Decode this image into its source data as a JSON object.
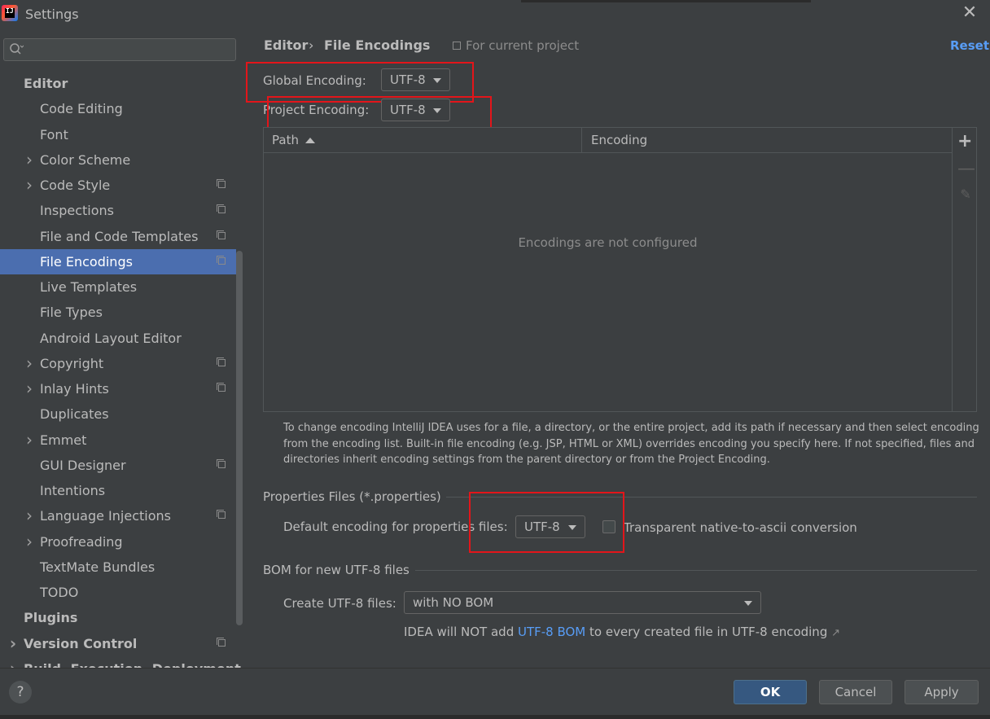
{
  "window": {
    "title": "Settings",
    "close_icon": "close-icon"
  },
  "search": {
    "placeholder": ""
  },
  "sidebar": {
    "items": [
      {
        "label": "Editor",
        "level": 0,
        "expandable": false,
        "project_scope": false,
        "selected": false
      },
      {
        "label": "Code Editing",
        "level": 1,
        "expandable": false,
        "project_scope": false,
        "selected": false
      },
      {
        "label": "Font",
        "level": 1,
        "expandable": false,
        "project_scope": false,
        "selected": false
      },
      {
        "label": "Color Scheme",
        "level": 1,
        "expandable": true,
        "project_scope": false,
        "selected": false
      },
      {
        "label": "Code Style",
        "level": 1,
        "expandable": true,
        "project_scope": true,
        "selected": false
      },
      {
        "label": "Inspections",
        "level": 1,
        "expandable": false,
        "project_scope": true,
        "selected": false
      },
      {
        "label": "File and Code Templates",
        "level": 1,
        "expandable": false,
        "project_scope": true,
        "selected": false
      },
      {
        "label": "File Encodings",
        "level": 1,
        "expandable": false,
        "project_scope": true,
        "selected": true
      },
      {
        "label": "Live Templates",
        "level": 1,
        "expandable": false,
        "project_scope": false,
        "selected": false
      },
      {
        "label": "File Types",
        "level": 1,
        "expandable": false,
        "project_scope": false,
        "selected": false
      },
      {
        "label": "Android Layout Editor",
        "level": 1,
        "expandable": false,
        "project_scope": false,
        "selected": false
      },
      {
        "label": "Copyright",
        "level": 1,
        "expandable": true,
        "project_scope": true,
        "selected": false
      },
      {
        "label": "Inlay Hints",
        "level": 1,
        "expandable": true,
        "project_scope": true,
        "selected": false
      },
      {
        "label": "Duplicates",
        "level": 1,
        "expandable": false,
        "project_scope": false,
        "selected": false
      },
      {
        "label": "Emmet",
        "level": 1,
        "expandable": true,
        "project_scope": false,
        "selected": false
      },
      {
        "label": "GUI Designer",
        "level": 1,
        "expandable": false,
        "project_scope": true,
        "selected": false
      },
      {
        "label": "Intentions",
        "level": 1,
        "expandable": false,
        "project_scope": false,
        "selected": false
      },
      {
        "label": "Language Injections",
        "level": 1,
        "expandable": true,
        "project_scope": true,
        "selected": false
      },
      {
        "label": "Proofreading",
        "level": 1,
        "expandable": true,
        "project_scope": false,
        "selected": false
      },
      {
        "label": "TextMate Bundles",
        "level": 1,
        "expandable": false,
        "project_scope": false,
        "selected": false
      },
      {
        "label": "TODO",
        "level": 1,
        "expandable": false,
        "project_scope": false,
        "selected": false
      },
      {
        "label": "Plugins",
        "level": 0,
        "expandable": false,
        "project_scope": false,
        "selected": false
      },
      {
        "label": "Version Control",
        "level": 0,
        "expandable": true,
        "project_scope": true,
        "selected": false
      },
      {
        "label": "Build, Execution, Deployment",
        "level": 0,
        "expandable": true,
        "project_scope": false,
        "selected": false
      }
    ]
  },
  "breadcrumb": {
    "parent": "Editor",
    "separator": "›",
    "current": "File Encodings",
    "scope": "For current project"
  },
  "reset_label": "Reset",
  "global_encoding": {
    "label": "Global Encoding:",
    "value": "UTF-8"
  },
  "project_encoding": {
    "label": "Project Encoding:",
    "value": "UTF-8"
  },
  "table": {
    "columns": [
      "Path",
      "Encoding"
    ],
    "empty_text": "Encodings are not configured",
    "toolbar": {
      "add": "+",
      "remove": "—",
      "edit": "✎"
    }
  },
  "note": "To change encoding IntelliJ IDEA uses for a file, a directory, or the entire project, add its path if necessary and then select encoding from the encoding list. Built-in file encoding (e.g. JSP, HTML or XML) overrides encoding you specify here. If not specified, files and directories inherit encoding settings from the parent directory or from the Project Encoding.",
  "properties": {
    "section_title": "Properties Files (*.properties)",
    "default_label": "Default encoding for properties files:",
    "default_value": "UTF-8",
    "transparent_label": "Transparent native-to-ascii conversion",
    "transparent_checked": false
  },
  "bom": {
    "section_title": "BOM for new UTF-8 files",
    "create_label": "Create UTF-8 files:",
    "create_value": "with NO BOM",
    "note_prefix": "IDEA will NOT add ",
    "note_link": "UTF-8 BOM",
    "note_suffix": " to every created file in UTF-8 encoding",
    "note_arrow": "↗"
  },
  "footer": {
    "help": "?",
    "ok": "OK",
    "cancel": "Cancel",
    "apply": "Apply"
  },
  "colors": {
    "background": "#3c3f41",
    "selection": "#4b6eaf",
    "link": "#589df6",
    "highlight_box": "#e3151a",
    "ok_button": "#365880"
  }
}
